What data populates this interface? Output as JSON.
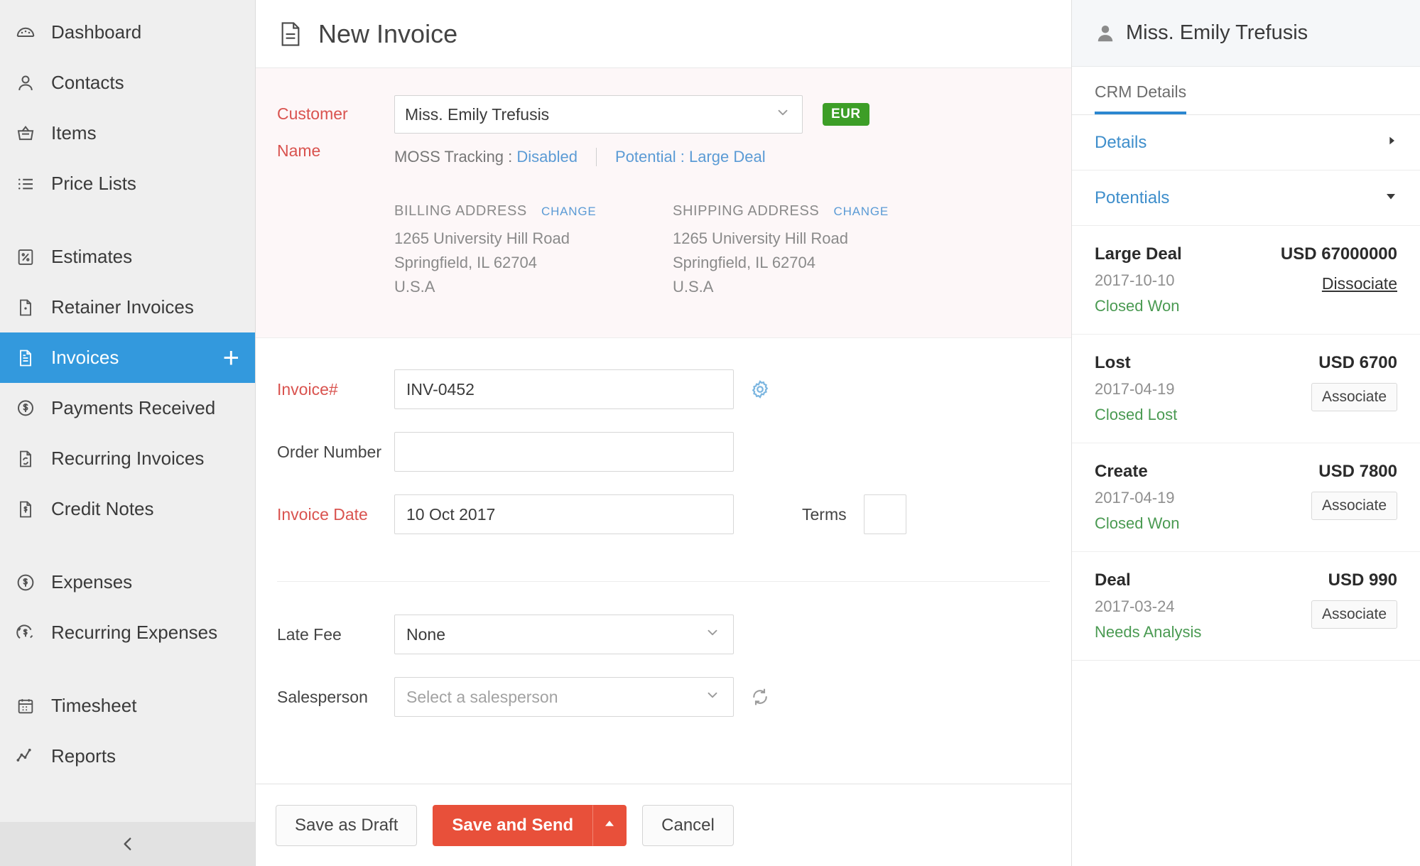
{
  "sidebar": {
    "groups": [
      {
        "items": [
          {
            "label": "Dashboard",
            "icon": "dashboard-icon"
          },
          {
            "label": "Contacts",
            "icon": "contacts-icon"
          },
          {
            "label": "Items",
            "icon": "items-icon"
          },
          {
            "label": "Price Lists",
            "icon": "price-lists-icon"
          }
        ]
      },
      {
        "items": [
          {
            "label": "Estimates",
            "icon": "estimates-icon"
          },
          {
            "label": "Retainer Invoices",
            "icon": "retainer-invoices-icon"
          },
          {
            "label": "Invoices",
            "icon": "invoices-icon",
            "active": true,
            "add": "+"
          },
          {
            "label": "Payments Received",
            "icon": "payments-received-icon"
          },
          {
            "label": "Recurring Invoices",
            "icon": "recurring-invoices-icon"
          },
          {
            "label": "Credit Notes",
            "icon": "credit-notes-icon"
          }
        ]
      },
      {
        "items": [
          {
            "label": "Expenses",
            "icon": "expenses-icon"
          },
          {
            "label": "Recurring Expenses",
            "icon": "recurring-expenses-icon"
          }
        ]
      },
      {
        "items": [
          {
            "label": "Timesheet",
            "icon": "timesheet-icon"
          },
          {
            "label": "Reports",
            "icon": "reports-icon"
          }
        ]
      }
    ],
    "collapse_icon": "chevron-left-icon"
  },
  "main": {
    "page_title": "New Invoice",
    "page_icon": "document-icon",
    "customer": {
      "label": "Customer Name",
      "value": "Miss. Emily Trefusis",
      "currency_badge": "EUR",
      "moss_label": "MOSS Tracking :",
      "moss_value": "Disabled",
      "potential_label": "Potential :",
      "potential_value": "Large Deal"
    },
    "billing": {
      "heading": "BILLING ADDRESS",
      "change": "CHANGE",
      "lines": [
        "1265 University Hill Road",
        "Springfield, IL 62704",
        "U.S.A"
      ]
    },
    "shipping": {
      "heading": "SHIPPING ADDRESS",
      "change": "CHANGE",
      "lines": [
        "1265 University Hill Road",
        "Springfield, IL 62704",
        "U.S.A"
      ]
    },
    "fields": {
      "invoice_no_label": "Invoice#",
      "invoice_no_value": "INV-0452",
      "invoice_no_settings_icon": "gear-icon",
      "order_no_label": "Order Number",
      "order_no_value": "",
      "order_no_placeholder": "",
      "invoice_date_label": "Invoice Date",
      "invoice_date_value": "10 Oct 2017",
      "terms_label": "Terms",
      "terms_value": "",
      "late_fee_label": "Late Fee",
      "late_fee_value": "None",
      "salesperson_label": "Salesperson",
      "salesperson_placeholder": "Select a salesperson",
      "salesperson_refresh_icon": "refresh-icon"
    },
    "footer": {
      "save_draft": "Save as Draft",
      "save_send": "Save and Send",
      "save_send_more_icon": "caret-up-icon",
      "cancel": "Cancel"
    }
  },
  "crm": {
    "person_icon": "person-icon",
    "name": "Miss. Emily Trefusis",
    "tab": "CRM Details",
    "sections": [
      {
        "label": "Details",
        "icon": "caret-right-icon",
        "expanded": false
      },
      {
        "label": "Potentials",
        "icon": "caret-down-icon",
        "expanded": true
      }
    ],
    "potentials": [
      {
        "name": "Large Deal",
        "date": "2017-10-10",
        "stage": "Closed Won",
        "amount": "USD 67000000",
        "action": "Dissociate",
        "action_type": "link"
      },
      {
        "name": "Lost",
        "date": "2017-04-19",
        "stage": "Closed Lost",
        "amount": "USD 6700",
        "action": "Associate",
        "action_type": "button"
      },
      {
        "name": "Create",
        "date": "2017-04-19",
        "stage": "Closed Won",
        "amount": "USD 7800",
        "action": "Associate",
        "action_type": "button"
      },
      {
        "name": "Deal",
        "date": "2017-03-24",
        "stage": "Needs Analysis",
        "amount": "USD 990",
        "action": "Associate",
        "action_type": "button"
      }
    ]
  },
  "colors": {
    "accent_blue": "#3399dd",
    "primary_red": "#e8503a",
    "badge_green": "#3d9e27",
    "stage_green": "#4a9a52",
    "required_red": "#d9534f",
    "link_blue": "#5b9bd5"
  }
}
